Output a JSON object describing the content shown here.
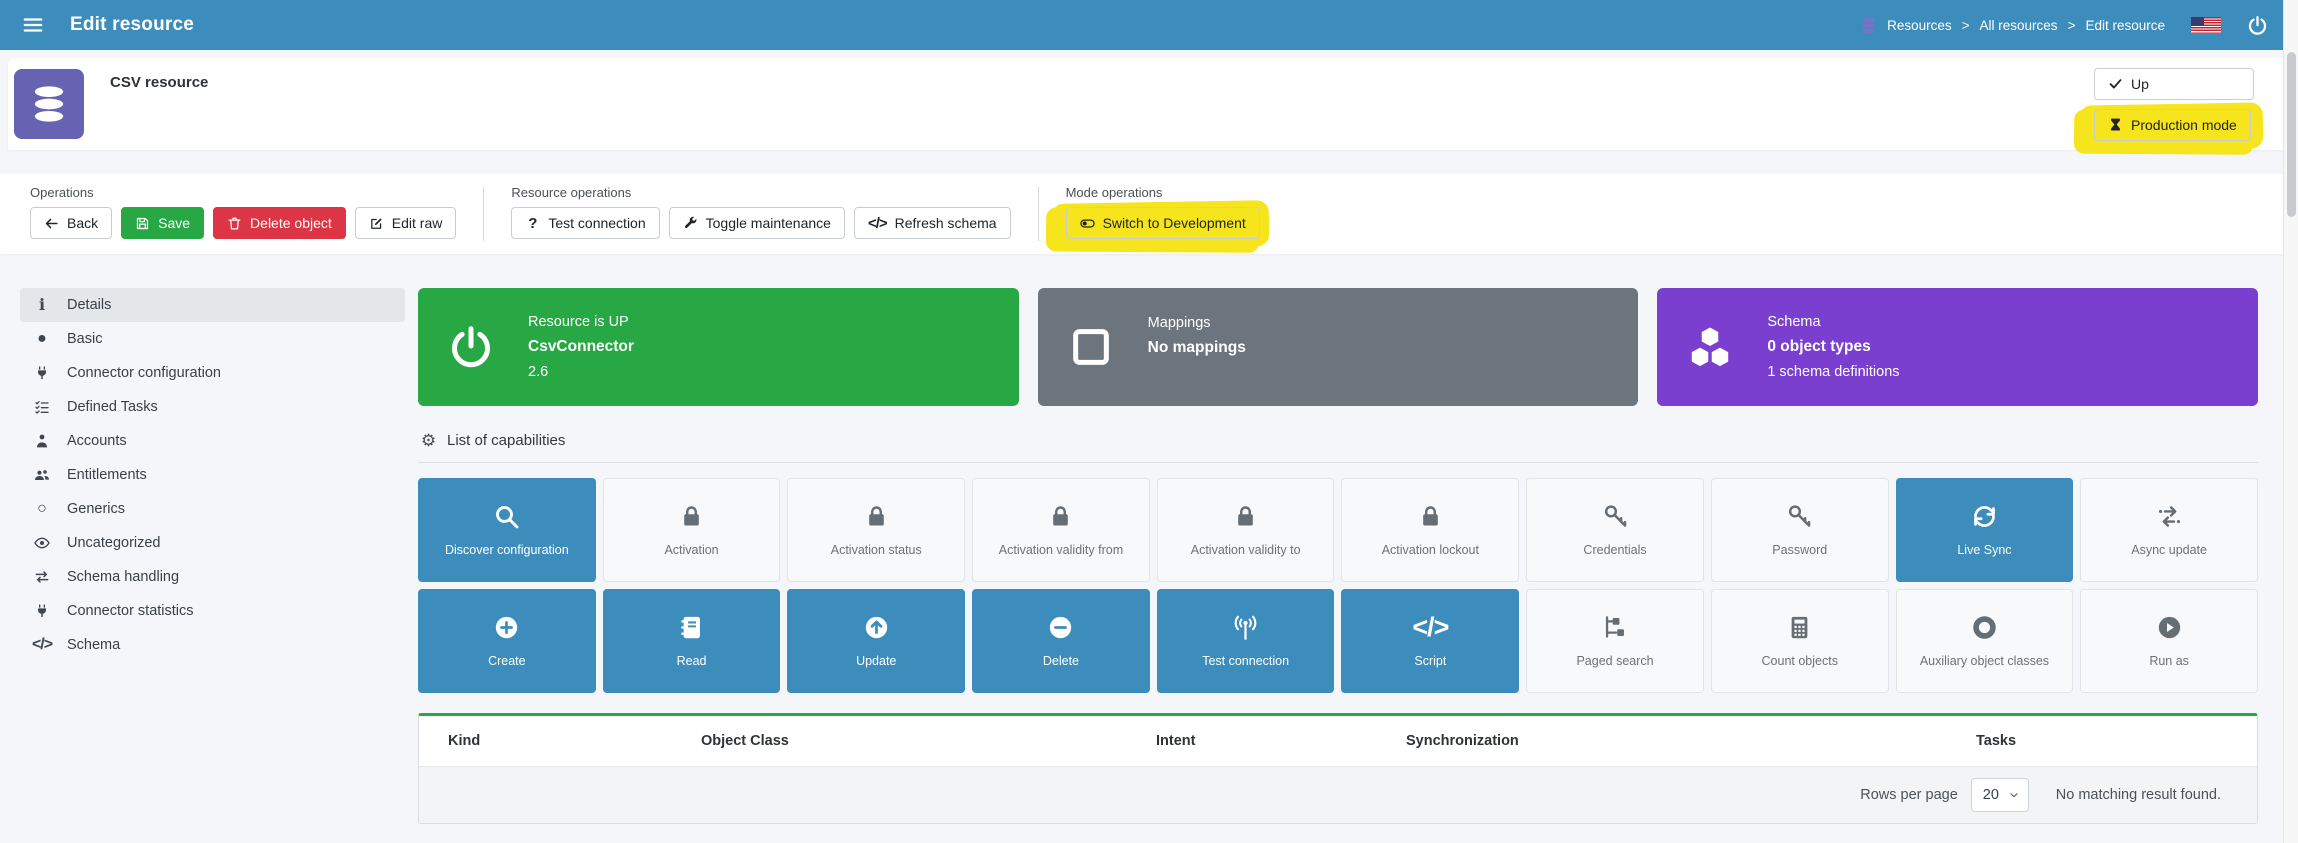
{
  "topbar": {
    "title": "Edit resource",
    "menu_icon": "bars",
    "power_icon": "power",
    "breadcrumb": {
      "icon": "database",
      "separator": ">",
      "items": [
        "Resources",
        "All resources",
        "Edit resource"
      ]
    }
  },
  "resource_header": {
    "icon": "database",
    "title": "CSV resource",
    "buttons": {
      "up": {
        "label": "Up",
        "icon": "check"
      },
      "production": {
        "label": "Production mode",
        "icon": "hourglass",
        "highlighted": true
      }
    }
  },
  "toolbar": {
    "operations": {
      "label": "Operations",
      "buttons": [
        {
          "label": "Back",
          "icon": "arrow-left",
          "style": "outline"
        },
        {
          "label": "Save",
          "icon": "floppy",
          "style": "success"
        },
        {
          "label": "Delete object",
          "icon": "trash",
          "style": "danger"
        },
        {
          "label": "Edit raw",
          "icon": "edit",
          "style": "outline"
        }
      ]
    },
    "resource_operations": {
      "label": "Resource operations",
      "buttons": [
        {
          "label": "Test connection",
          "icon": "question",
          "style": "outline"
        },
        {
          "label": "Toggle maintenance",
          "icon": "wrench",
          "style": "outline"
        },
        {
          "label": "Refresh schema",
          "icon": "code",
          "style": "outline"
        }
      ]
    },
    "mode_operations": {
      "label": "Mode operations",
      "buttons": [
        {
          "label": "Switch to Development",
          "icon": "toggle",
          "style": "outline",
          "highlighted": true
        }
      ]
    }
  },
  "sidebar": {
    "items": [
      {
        "label": "Details",
        "icon": "info",
        "active": true
      },
      {
        "label": "Basic",
        "icon": "circle",
        "active": false
      },
      {
        "label": "Connector configuration",
        "icon": "plug",
        "active": false
      },
      {
        "label": "Defined Tasks",
        "icon": "tasks",
        "active": false
      },
      {
        "label": "Accounts",
        "icon": "person",
        "active": false
      },
      {
        "label": "Entitlements",
        "icon": "users",
        "active": false
      },
      {
        "label": "Generics",
        "icon": "circle-o",
        "active": false
      },
      {
        "label": "Uncategorized",
        "icon": "eye",
        "active": false
      },
      {
        "label": "Schema handling",
        "icon": "exchange",
        "active": false
      },
      {
        "label": "Connector statistics",
        "icon": "plug",
        "active": false
      },
      {
        "label": "Schema",
        "icon": "code",
        "active": false
      }
    ]
  },
  "status_cards": [
    {
      "color": "green",
      "icon": "power",
      "line1": "Resource is UP",
      "line2": "CsvConnector",
      "line3": "2.6"
    },
    {
      "color": "gray",
      "icon": "square-o",
      "line1": "Mappings",
      "line2": "No mappings",
      "line3": ""
    },
    {
      "color": "purple",
      "icon": "cubes",
      "line1": "Schema",
      "line2": "0 object types",
      "line3": "1 schema definitions"
    }
  ],
  "capabilities": {
    "title": "List of capabilities",
    "icon": "gear",
    "tiles": [
      {
        "label": "Discover configuration",
        "icon": "search",
        "active": true
      },
      {
        "label": "Activation",
        "icon": "lock",
        "active": false
      },
      {
        "label": "Activation status",
        "icon": "lock",
        "active": false
      },
      {
        "label": "Activation validity from",
        "icon": "lock",
        "active": false
      },
      {
        "label": "Activation validity to",
        "icon": "lock",
        "active": false
      },
      {
        "label": "Activation lockout",
        "icon": "lock",
        "active": false
      },
      {
        "label": "Credentials",
        "icon": "key",
        "active": false
      },
      {
        "label": "Password",
        "icon": "key",
        "active": false
      },
      {
        "label": "Live Sync",
        "icon": "sync",
        "active": true
      },
      {
        "label": "Async update",
        "icon": "async",
        "active": false
      },
      {
        "label": "Create",
        "icon": "plus-circle",
        "active": true
      },
      {
        "label": "Read",
        "icon": "read",
        "active": true
      },
      {
        "label": "Update",
        "icon": "arrow-up-circle",
        "active": true
      },
      {
        "label": "Delete",
        "icon": "minus-circle",
        "active": true
      },
      {
        "label": "Test connection",
        "icon": "broadcast",
        "active": true
      },
      {
        "label": "Script",
        "icon": "code",
        "active": true
      },
      {
        "label": "Paged search",
        "icon": "sitemap",
        "active": false
      },
      {
        "label": "Count objects",
        "icon": "calculator",
        "active": false
      },
      {
        "label": "Auxiliary object classes",
        "icon": "donut",
        "active": false
      },
      {
        "label": "Run as",
        "icon": "play-circle",
        "active": false
      }
    ]
  },
  "object_types_table": {
    "headers": [
      "Kind",
      "Object Class",
      "Intent",
      "Synchronization",
      "Tasks"
    ],
    "footer": {
      "rows_per_page_label": "Rows per page",
      "rows_per_page_value": "20",
      "chevron_icon": "chevron-down",
      "empty_message": "No matching result found."
    }
  },
  "colors": {
    "navbar_blue": "#3c8dbc",
    "tile_active_blue": "#3c8dbc",
    "success_green": "#28a745",
    "danger_red": "#dc3545",
    "card_gray": "#6c757d",
    "card_purple": "#7b3fd0",
    "header_icon_purple": "#6664b2",
    "highlight_yellow": "#f6e41d"
  }
}
